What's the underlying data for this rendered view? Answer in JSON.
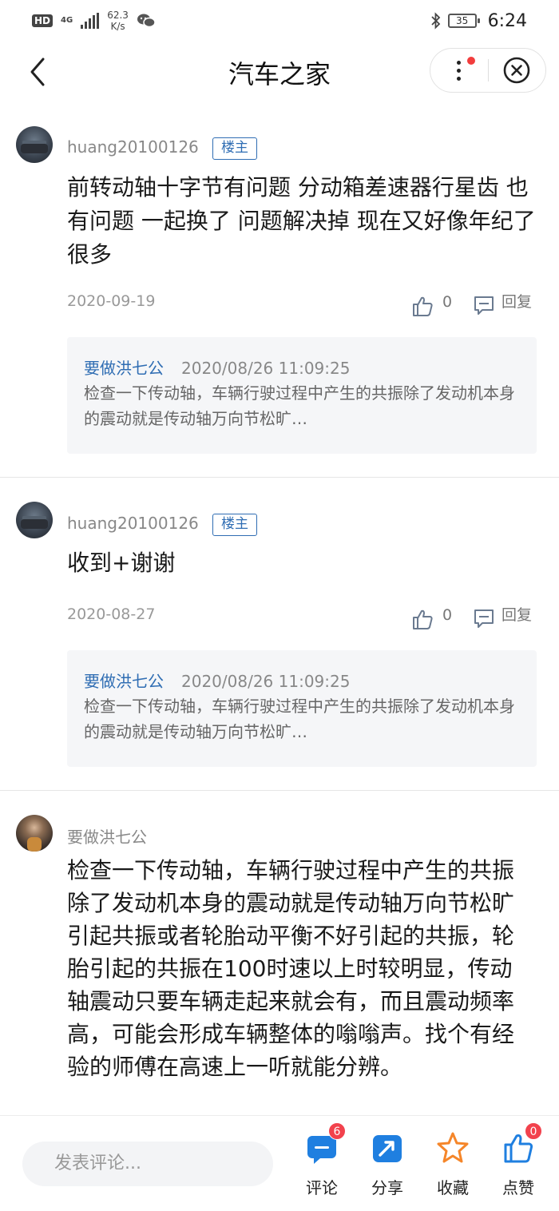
{
  "status_bar": {
    "hd": "HD",
    "network": "4G",
    "speed_value": "62.3",
    "speed_unit": "K/s",
    "battery": "35",
    "time": "6:24"
  },
  "nav": {
    "title": "汽车之家",
    "back_icon": "chevron-left-icon",
    "more_icon": "more-vertical-icon",
    "close_icon": "close-circle-icon",
    "notification_dot_color": "#f23d3d"
  },
  "posts": [
    {
      "author": "huang20100126",
      "badge": "楼主",
      "text": "前转动轴十字节有问题 分动箱差速器行星齿 也有问题 一起换了 问题解决掉 现在又好像年纪了很多",
      "date": "2020-09-19",
      "likes": "0",
      "reply_label": "回复",
      "quote": {
        "author": "要做洪七公",
        "time": "2020/08/26 11:09:25",
        "text": "检查一下传动轴，车辆行驶过程中产生的共振除了发动机本身的震动就是传动轴万向节松旷…"
      }
    },
    {
      "author": "huang20100126",
      "badge": "楼主",
      "text": "收到+谢谢",
      "date": "2020-08-27",
      "likes": "0",
      "reply_label": "回复",
      "quote": {
        "author": "要做洪七公",
        "time": "2020/08/26 11:09:25",
        "text": "检查一下传动轴，车辆行驶过程中产生的共振除了发动机本身的震动就是传动轴万向节松旷…"
      }
    },
    {
      "author": "要做洪七公",
      "text": "检查一下传动轴，车辆行驶过程中产生的共振除了发动机本身的震动就是传动轴万向节松旷引起共振或者轮胎动平衡不好引起的共振，轮胎引起的共振在100时速以上时较明显，传动轴震动只要车辆走起来就会有，而且震动频率高，可能会形成车辆整体的嗡嗡声。找个有经验的师傅在高速上一听就能分辨。"
    }
  ],
  "bottom_bar": {
    "comment_placeholder": "发表评论...",
    "comment": {
      "label": "评论",
      "badge": "6",
      "icon": "comment-icon"
    },
    "share": {
      "label": "分享",
      "icon": "share-icon"
    },
    "favorite": {
      "label": "收藏",
      "icon": "star-icon"
    },
    "like": {
      "label": "点赞",
      "badge": "0",
      "icon": "thumbs-up-icon"
    }
  },
  "colors": {
    "accent_blue": "#2f6db3",
    "icon_blue": "#1f7fe0",
    "star_orange": "#f5862a",
    "badge_red": "#f2424d"
  }
}
